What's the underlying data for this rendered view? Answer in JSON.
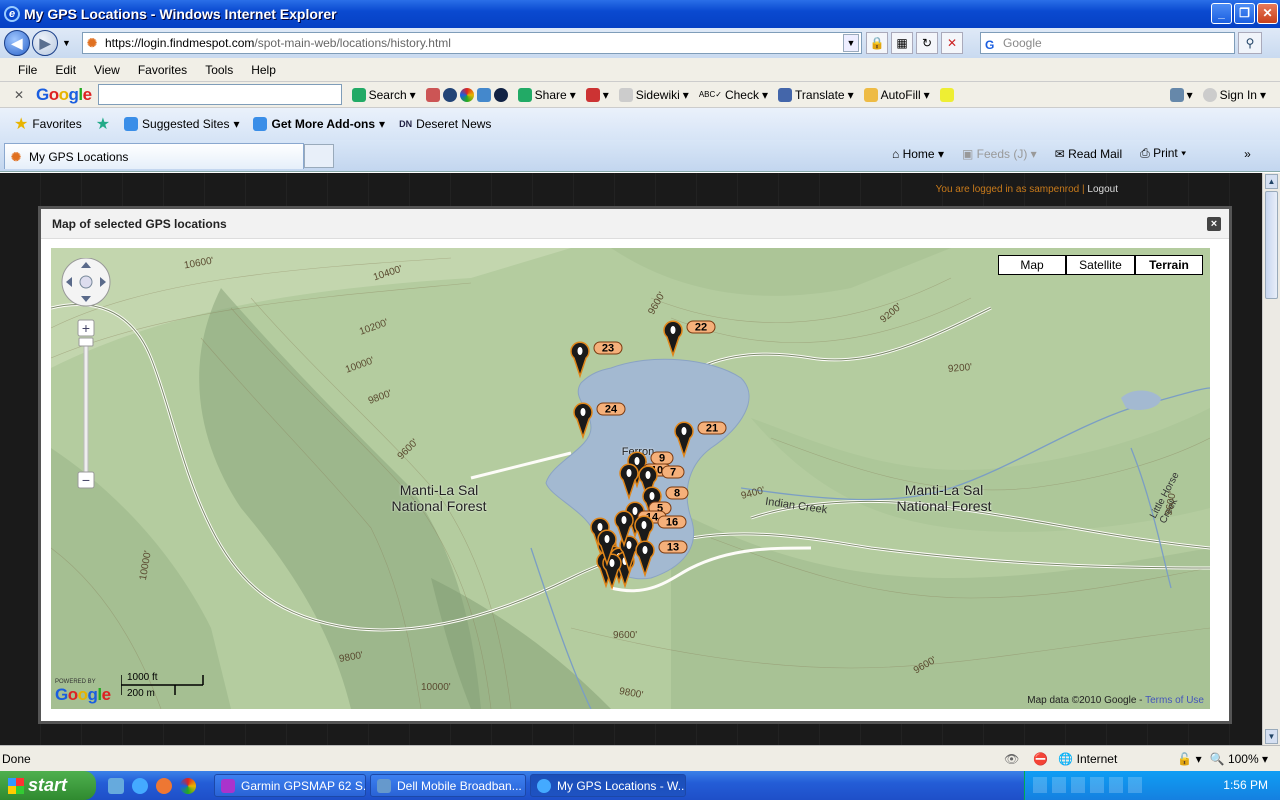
{
  "window": {
    "title": "My GPS Locations - Windows Internet Explorer"
  },
  "address": {
    "scheme": "https://login.",
    "host": "findmespot.com",
    "path": "/spot-main-web/locations/history.html",
    "search_placeholder": "Google"
  },
  "menu": [
    "File",
    "Edit",
    "View",
    "Favorites",
    "Tools",
    "Help"
  ],
  "googlebar": {
    "logo": "Google",
    "items": [
      "Search",
      "Share",
      "Sidewiki",
      "Check",
      "Translate",
      "AutoFill",
      "Sign In"
    ]
  },
  "favbar": {
    "favorites": "Favorites",
    "items": [
      "Suggested Sites",
      "Get More Add-ons",
      "Deseret News"
    ]
  },
  "tab": {
    "label": "My GPS Locations"
  },
  "commandbar": {
    "home": "Home",
    "feeds": "Feeds (J)",
    "readmail": "Read Mail",
    "print": "Print"
  },
  "page": {
    "login_prefix": "You are logged in as ",
    "username": "sampenrod",
    "logout": "Logout"
  },
  "modal": {
    "title": "Map of selected GPS locations",
    "close": "×",
    "map_types": [
      "Map",
      "Satellite",
      "Terrain"
    ],
    "selected_map_type": "Terrain",
    "labels": {
      "forest_left": "Manti-La Sal\nNational Forest",
      "forest_right": "Manti-La Sal\nNational Forest",
      "reservoir": "Ferron\nRes",
      "indian_creek": "Indian Creek",
      "little_horse_creek": "Little Horse Creek"
    },
    "contours": [
      "10600'",
      "10400'",
      "10200'",
      "10000'",
      "9800'",
      "9600'",
      "9600'",
      "9200'",
      "9400'",
      "9200'",
      "10000'",
      "9800'",
      "10000'",
      "9600'",
      "9800'",
      "9600'",
      "9600'"
    ],
    "markers": [
      "23",
      "22",
      "24",
      "21",
      "9",
      "10",
      "7",
      "8",
      "5",
      "14",
      "16",
      "13"
    ],
    "scale": {
      "ft": "1000 ft",
      "m": "200 m"
    },
    "powered_by": "POWERED BY",
    "google": "Google",
    "map_data": "Map data ©2010 Google - ",
    "terms": "Terms of Use"
  },
  "status": {
    "left": "Done",
    "zone": "Internet",
    "zoom": "100%"
  },
  "taskbar": {
    "start": "start",
    "tasks": [
      "Garmin GPSMAP 62 S...",
      "Dell Mobile Broadban...",
      "My GPS Locations - W..."
    ],
    "clock": "1:56 PM"
  }
}
